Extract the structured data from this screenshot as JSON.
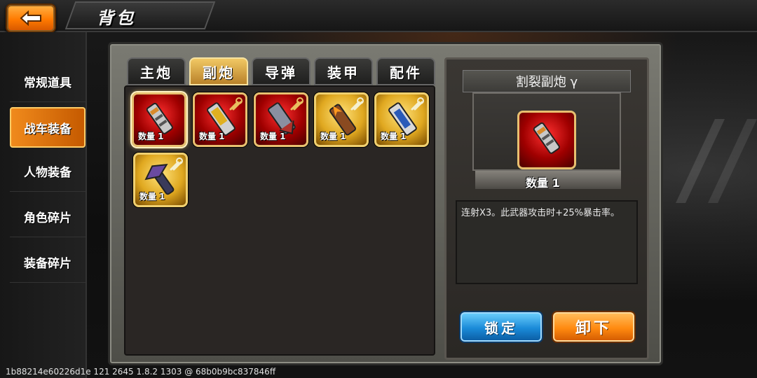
{
  "header": {
    "title": "背包"
  },
  "sidebar": {
    "items": [
      {
        "label": "常规道具",
        "active": false
      },
      {
        "label": "战车装备",
        "active": true
      },
      {
        "label": "人物装备",
        "active": false
      },
      {
        "label": "角色碎片",
        "active": false
      },
      {
        "label": "装备碎片",
        "active": false
      }
    ]
  },
  "tabs": [
    {
      "label": "主炮",
      "active": false
    },
    {
      "label": "副炮",
      "active": true
    },
    {
      "label": "导弹",
      "active": false
    },
    {
      "label": "装甲",
      "active": false
    },
    {
      "label": "配件",
      "active": false
    }
  ],
  "inventory": {
    "items": [
      {
        "qty_label": "数量 1",
        "rarity": "red",
        "selected": true,
        "upgradable": false
      },
      {
        "qty_label": "数量 1",
        "rarity": "red",
        "selected": false,
        "upgradable": true
      },
      {
        "qty_label": "数量 1",
        "rarity": "red",
        "selected": false,
        "upgradable": true
      },
      {
        "qty_label": "数量 1",
        "rarity": "gold",
        "selected": false,
        "upgradable": true
      },
      {
        "qty_label": "数量 1",
        "rarity": "gold",
        "selected": false,
        "upgradable": true
      },
      {
        "qty_label": "数量 1",
        "rarity": "gold",
        "selected": false,
        "upgradable": true
      }
    ]
  },
  "detail": {
    "name": "割裂副炮 γ",
    "qty_label": "数量 1",
    "description": "连射X3。此武器攻击时+25%暴击率。",
    "lock_label": "锁定",
    "unequip_label": "卸下"
  },
  "debug": {
    "text": "1b88214e60226d1e 121 2645 1.8.2 1303 @ 68b0b9bc837846ff"
  },
  "colors": {
    "accent_orange": "#ff8a10",
    "lock_blue": "#1a8ad8",
    "rarity_red": "#a00000",
    "rarity_gold": "#e0a820"
  }
}
